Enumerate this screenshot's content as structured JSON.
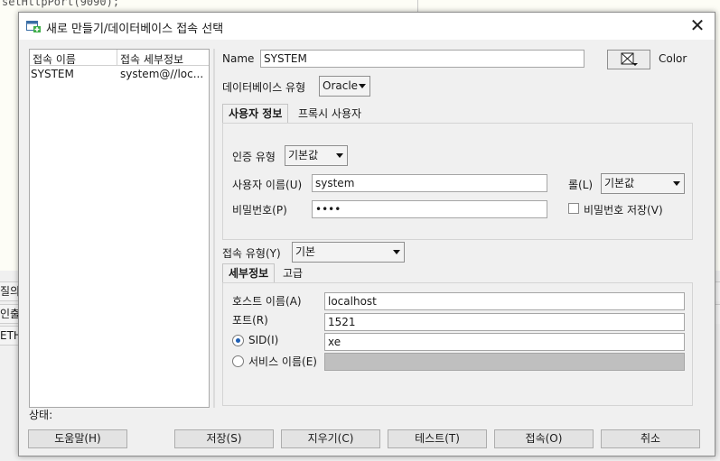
{
  "background": {
    "code_line": "setHttpPort(9090);",
    "side_rows": [
      "질의",
      "인출",
      "ETH"
    ]
  },
  "dialog": {
    "title": "새로 만들기/데이터베이스 접속 선택",
    "close_glyph": "✕"
  },
  "connections": {
    "headers": [
      "접속 이름",
      "접속 세부정보"
    ],
    "rows": [
      {
        "name": "SYSTEM",
        "details": "system@//loc..."
      }
    ]
  },
  "form": {
    "name_label": "Name",
    "name_value": "SYSTEM",
    "color_label": "Color",
    "db_type_label": "데이터베이스 유형",
    "db_type_value": "Oracle",
    "user_tabs": [
      "사용자 정보",
      "프록시 사용자"
    ],
    "auth_type_label": "인증 유형",
    "auth_type_value": "기본값",
    "username_label": "사용자 이름(U)",
    "username_value": "system",
    "role_label": "롤(L)",
    "role_value": "기본값",
    "password_label": "비밀번호(P)",
    "password_value": "••••",
    "save_password_label": "비밀번호 저장(V)",
    "conn_type_label": "접속 유형(Y)",
    "conn_type_value": "기본",
    "detail_tabs": [
      "세부정보",
      "고급"
    ],
    "host_label": "호스트 이름(A)",
    "host_value": "localhost",
    "port_label": "포트(R)",
    "port_value": "1521",
    "sid_label": "SID(I)",
    "sid_value": "xe",
    "service_label": "서비스 이름(E)",
    "service_value": ""
  },
  "status_label": "상태:",
  "buttons": {
    "help": "도움말(H)",
    "save": "저장(S)",
    "clear": "지우기(C)",
    "test": "테스트(T)",
    "connect": "접속(O)",
    "cancel": "취소"
  },
  "colors": {
    "dialog_bg": "#f0f0f0",
    "radio_selected": "#1f5fb4"
  }
}
